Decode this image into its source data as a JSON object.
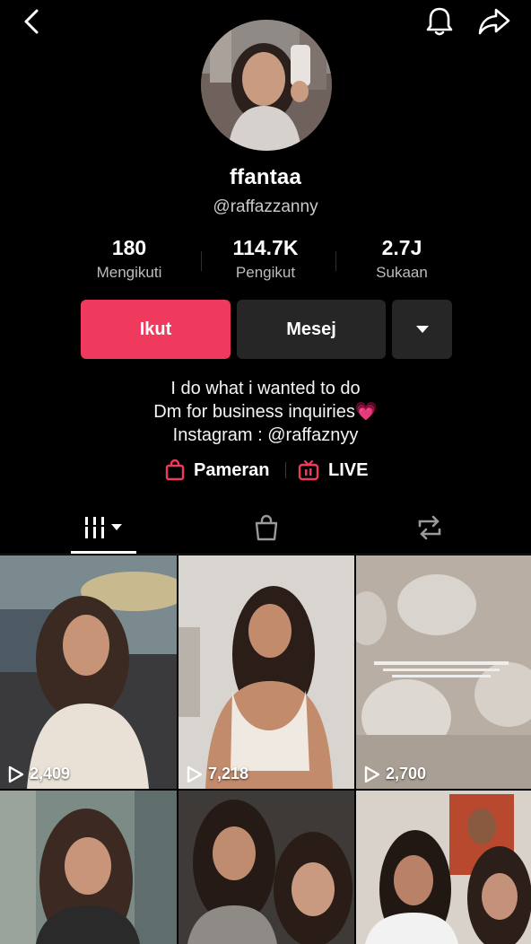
{
  "profile": {
    "display_name": "ffantaa",
    "handle": "@raffazzanny",
    "avatar_icon": "profile-photo"
  },
  "stats": [
    {
      "value": "180",
      "label": "Mengikuti"
    },
    {
      "value": "114.7K",
      "label": "Pengikut"
    },
    {
      "value": "2.7J",
      "label": "Sukaan"
    }
  ],
  "actions": {
    "follow_label": "Ikut",
    "message_label": "Mesej",
    "more_icon": "caret-down-icon"
  },
  "bio": {
    "lines": [
      "I do what i wanted to do",
      "Dm for business inquiries💗",
      "Instagram : @raffaznyy"
    ]
  },
  "links": {
    "shop_label": "Pameran",
    "live_label": "LIVE"
  },
  "tabs": [
    {
      "icon": "grid-videos-icon",
      "active": true
    },
    {
      "icon": "shopping-bag-icon",
      "active": false
    },
    {
      "icon": "repost-icon",
      "active": false
    }
  ],
  "videos": [
    {
      "views": "2,409"
    },
    {
      "views": "7,218"
    },
    {
      "views": "2,700"
    },
    {
      "views": ""
    },
    {
      "views": ""
    },
    {
      "views": ""
    }
  ],
  "colors": {
    "background": "#000000",
    "follow_button": "#ef3a5d",
    "secondary_button": "#262626",
    "accent_icon": "#ef3a5d"
  }
}
